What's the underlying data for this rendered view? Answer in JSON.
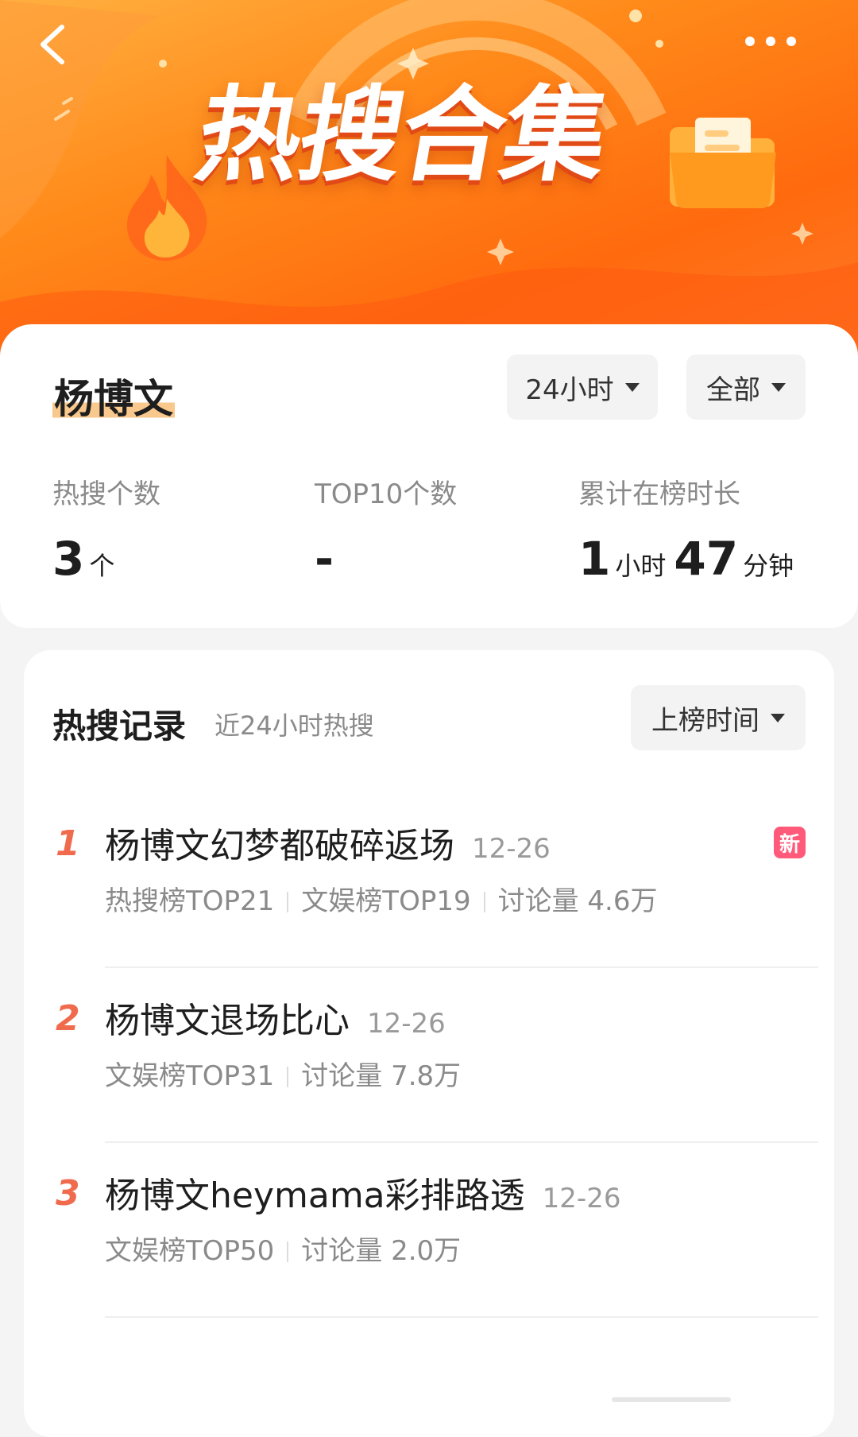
{
  "colors": {
    "banner_start": "#ffb040",
    "banner_end": "#ff6a0e",
    "accent_rank": "#f06b4d",
    "highlight": "#f9c88c",
    "badge_new": "#ff5a7a"
  },
  "banner": {
    "title": "热搜合集",
    "back_icon": "chevron-left-icon",
    "more_icon": "more-horizontal-icon"
  },
  "summary": {
    "name": "杨博文",
    "filters": {
      "range": "24小时",
      "scope": "全部"
    },
    "stats": [
      {
        "label": "热搜个数",
        "value": "3",
        "unit": "个"
      },
      {
        "label": "TOP10个数",
        "value": "-"
      },
      {
        "label": "累计在榜时长",
        "hours": "1",
        "hours_unit": "小时",
        "minutes": "47",
        "minutes_unit": "分钟"
      }
    ]
  },
  "records": {
    "title": "热搜记录",
    "subtitle": "近24小时热搜",
    "sort_label": "上榜时间",
    "items": [
      {
        "rank": "1",
        "title": "杨博文幻梦都破碎返场",
        "date": "12-26",
        "badge": "新",
        "meta": [
          "热搜榜TOP21",
          "文娱榜TOP19",
          "讨论量 4.6万"
        ]
      },
      {
        "rank": "2",
        "title": "杨博文退场比心",
        "date": "12-26",
        "meta": [
          "文娱榜TOP31",
          "讨论量 7.8万"
        ]
      },
      {
        "rank": "3",
        "title": "杨博文heymama彩排路透",
        "date": "12-26",
        "meta": [
          "文娱榜TOP50",
          "讨论量 2.0万"
        ]
      }
    ]
  }
}
